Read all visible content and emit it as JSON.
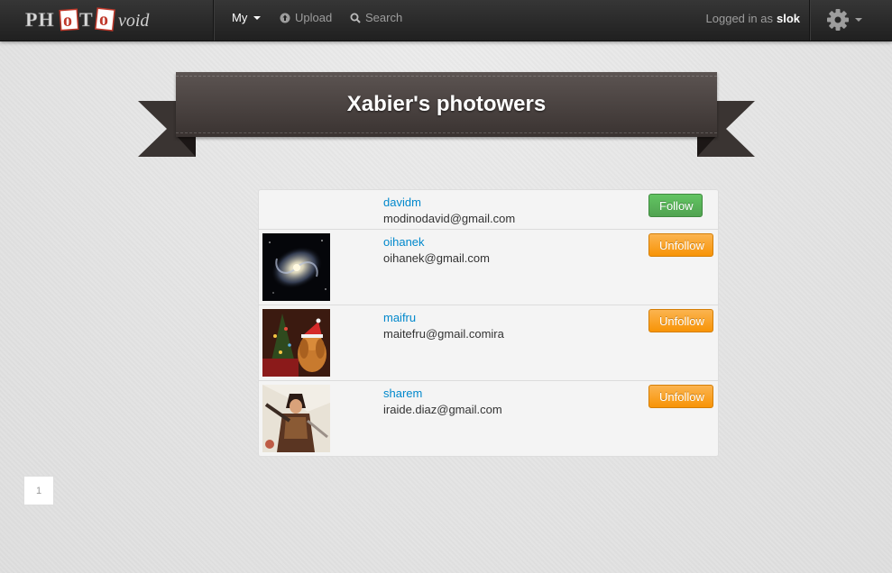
{
  "navbar": {
    "brand": "PHOTOvoid",
    "menu_my": "My",
    "menu_upload": "Upload",
    "menu_search": "Search",
    "logged_in_prefix": "Logged in as",
    "username": "slok"
  },
  "page": {
    "title": "Xabier's photowers"
  },
  "users": [
    {
      "username": "davidm",
      "email": "modinodavid@gmail.com",
      "action": "Follow",
      "thumbnail": "none"
    },
    {
      "username": "oihanek",
      "email": "oihanek@gmail.com",
      "action": "Unfollow",
      "thumbnail": "spiral-galaxy"
    },
    {
      "username": "maifru",
      "email": "maitefru@gmail.comira",
      "action": "Unfollow",
      "thumbnail": "dog-christmas-tree"
    },
    {
      "username": "sharem",
      "email": "iraide.diaz@gmail.com",
      "action": "Unfollow",
      "thumbnail": "fantasy-warrior"
    }
  ],
  "pagination": {
    "current_page": "1"
  },
  "colors": {
    "link": "#0088cc",
    "follow": "#5bb75b",
    "unfollow": "#f89406",
    "ribbon": "#4a4240"
  }
}
